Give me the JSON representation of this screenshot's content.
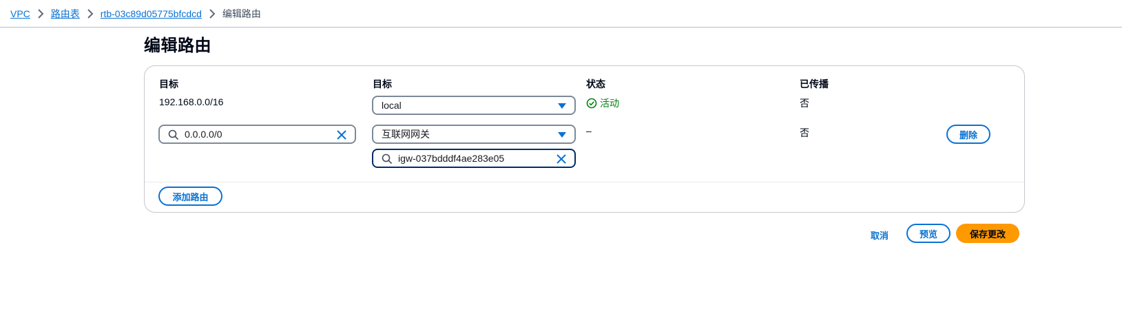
{
  "breadcrumb": {
    "items": [
      "VPC",
      "路由表",
      "rtb-03c89d05775bfcdcd"
    ],
    "current": "编辑路由"
  },
  "page": {
    "title": "编辑路由"
  },
  "table": {
    "headers": {
      "destination": "目标",
      "target": "目标",
      "status": "状态",
      "propagated": "已传播"
    },
    "rows": [
      {
        "destination": "192.168.0.0/16",
        "target": "local",
        "status": "活动",
        "propagated": "否"
      },
      {
        "destination": "0.0.0.0/0",
        "target": "互联网网关",
        "target_id": "igw-037bdddf4ae283e05",
        "status": "–",
        "propagated": "否",
        "remove_label": "删除"
      }
    ]
  },
  "actions": {
    "add_route": "添加路由",
    "cancel": "取消",
    "preview": "预览",
    "save": "保存更改"
  },
  "colors": {
    "link": "#0972d3",
    "primary": "#ff9900",
    "success": "#037f0c"
  }
}
